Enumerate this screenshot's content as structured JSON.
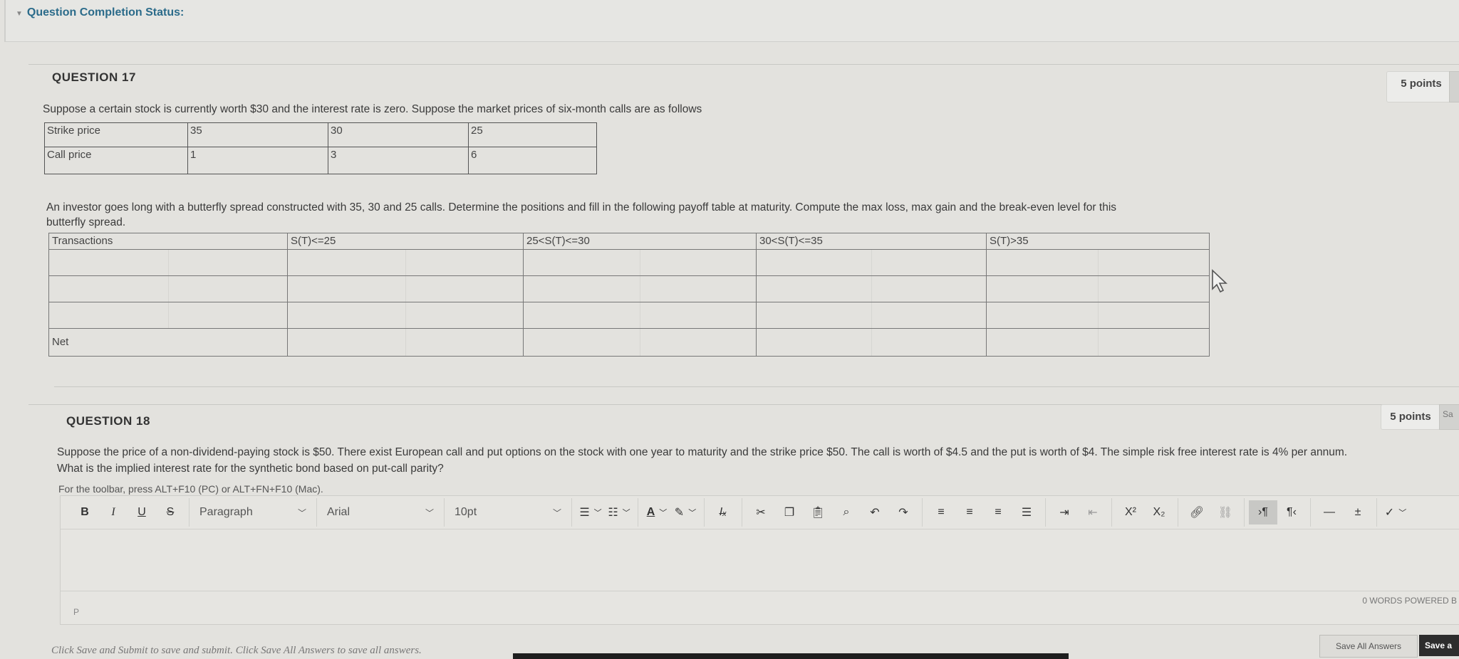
{
  "status_bar": {
    "title": "Question Completion Status:"
  },
  "q17": {
    "title": "QUESTION 17",
    "points": "5 points",
    "prompt": "Suppose a certain stock is currently worth $30 and the interest rate is zero. Suppose the market prices of six-month calls are as follows",
    "price_table": {
      "rows": [
        {
          "label": "Strike price",
          "values": [
            "35",
            "30",
            "25"
          ]
        },
        {
          "label": "Call price",
          "values": [
            "1",
            "3",
            "6"
          ]
        }
      ]
    },
    "instruction_line1": "An investor goes long with a butterfly spread constructed with 35, 30 and 25 calls. Determine the positions and fill in the following payoff table at maturity. Compute the max loss, max gain and the break-even level for this",
    "instruction_line2": "butterfly spread.",
    "payoff_table": {
      "headers": [
        "Transactions",
        "S(T)<=25",
        "25<S(T)<=30",
        "30<S(T)<=35",
        "S(T)>35"
      ],
      "net_label": "Net"
    }
  },
  "q18": {
    "title": "QUESTION 18",
    "points": "5 points",
    "points_tab": "Sa",
    "prompt_line1": "Suppose the price of a non-dividend-paying stock is $50. There exist European call and put options on the stock with one year to maturity and the strike price $50. The call is worth of $4.5 and the put is worth of $4. The simple risk free interest rate is 4% per annum.",
    "prompt_line2": "What is the implied interest rate for the synthetic bond based on put-call parity?",
    "toolbar_hint": "For the toolbar, press ALT+F10 (PC) or ALT+FN+F10 (Mac).",
    "editor": {
      "bold": "B",
      "italic": "I",
      "underline": "U",
      "strike": "S",
      "paragraph": "Paragraph",
      "font": "Arial",
      "size": "10pt",
      "path": "P",
      "word_count": "0 WORDS  POWERED B"
    }
  },
  "footer": {
    "note": "Click Save and Submit to save and submit. Click Save All Answers to save all answers.",
    "save_all": "Save All Answers",
    "save_submit": "Save a"
  },
  "icons": [
    "chevron-down-icon",
    "bullet-list-icon",
    "numbered-list-icon",
    "text-color-icon",
    "highlight-icon",
    "clear-format-icon",
    "cut-icon",
    "copy-icon",
    "paste-icon",
    "search-icon",
    "undo-icon",
    "redo-icon",
    "align-left-icon",
    "align-center-icon",
    "align-right-icon",
    "justify-icon",
    "indent-icon",
    "outdent-icon",
    "superscript-icon",
    "subscript-icon",
    "link-icon",
    "unlink-icon",
    "ltr-icon",
    "rtl-icon",
    "horizontal-rule-icon",
    "insert-icon",
    "spellcheck-icon",
    "mouse-pointer-icon"
  ]
}
